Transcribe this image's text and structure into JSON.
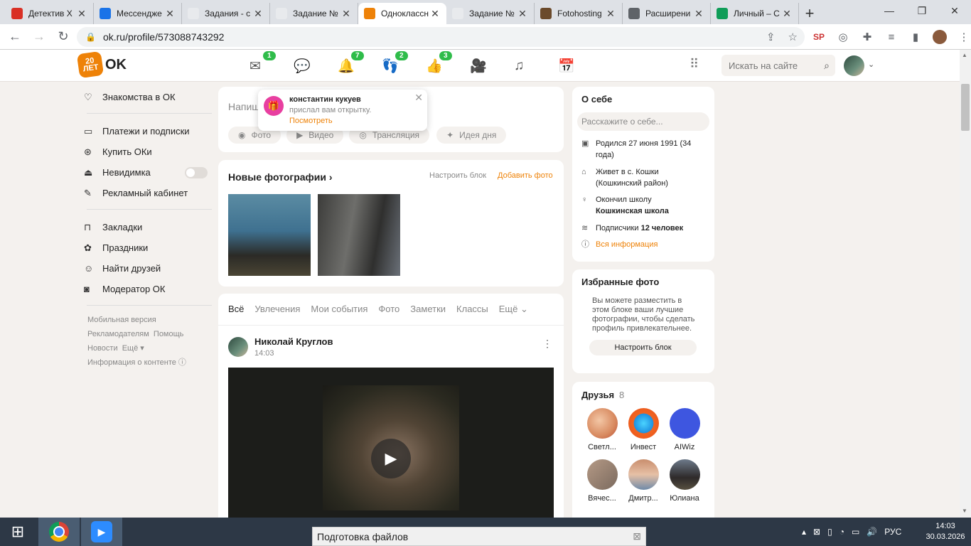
{
  "browser": {
    "tabs": [
      {
        "title": "Детектив Х",
        "icon_color": "#d93025",
        "active": false
      },
      {
        "title": "Мессендже",
        "icon_color": "#1a73e8",
        "active": false
      },
      {
        "title": "Задания - с",
        "icon_color": "#e8eaed",
        "active": false
      },
      {
        "title": "Задание №",
        "icon_color": "#e8eaed",
        "active": false
      },
      {
        "title": "Одноклассн",
        "icon_color": "#ee8208",
        "active": true
      },
      {
        "title": "Задание №",
        "icon_color": "#e8eaed",
        "active": false
      },
      {
        "title": "Fotohosting",
        "icon_color": "#6b4a2b",
        "active": false
      },
      {
        "title": "Расширени",
        "icon_color": "#5f6368",
        "active": false
      },
      {
        "title": "Личный – С",
        "icon_color": "#0f9d58",
        "active": false
      }
    ],
    "url": "ok.ru/profile/573088743292"
  },
  "site": {
    "logo_badge": "20 ЛЕТ",
    "logo_text": "OK",
    "nav": [
      {
        "icon": "mail-icon",
        "glyph": "✉",
        "count": "1"
      },
      {
        "icon": "chat-icon",
        "glyph": "💬",
        "count": ""
      },
      {
        "icon": "bell-icon",
        "glyph": "🔔",
        "count": "7"
      },
      {
        "icon": "guests-icon",
        "glyph": "👣",
        "count": "2"
      },
      {
        "icon": "like-icon",
        "glyph": "👍",
        "count": "3"
      },
      {
        "icon": "video-icon",
        "glyph": "🎥",
        "count": ""
      },
      {
        "icon": "music-icon",
        "glyph": "♫",
        "count": ""
      },
      {
        "icon": "calendar-icon",
        "glyph": "📅",
        "count": ""
      }
    ],
    "search_placeholder": "Искать на сайте"
  },
  "leftnav": {
    "top": "Знакомства в ОК",
    "group1": [
      "Платежи и подписки",
      "Купить ОКи",
      "Невидимка",
      "Рекламный кабинет"
    ],
    "group2": [
      "Закладки",
      "Праздники",
      "Найти друзей",
      "Модератор ОК"
    ],
    "footer": [
      "Мобильная версия",
      "Рекламодателям",
      "Помощь",
      "Новости",
      "Ещё ▾",
      "Информация о контенте ⓘ"
    ]
  },
  "postbox": {
    "placeholder": "Напиши",
    "buttons": [
      "Фото",
      "Видео",
      "Трансляция",
      "Идея дня"
    ]
  },
  "notification": {
    "name": "константин кукуев",
    "text": "прислал вам открытку.",
    "link": "Посмотреть"
  },
  "photos": {
    "title": "Новые фотографии ›",
    "configure": "Настроить блок",
    "add": "Добавить фото"
  },
  "feed": {
    "tabs": [
      "Всё",
      "Увлечения",
      "Мои события",
      "Фото",
      "Заметки",
      "Классы",
      "Ещё ⌄"
    ],
    "post": {
      "author": "Николай Круглов",
      "time": "14:03"
    }
  },
  "about": {
    "title": "О себе",
    "placeholder": "Расскажите о себе...",
    "born": "Родился 27 июня 1991 (34 года)",
    "lives": "Живет в с. Кошки (Кошкинский район)",
    "school_pre": "Окончил школу",
    "school": "Кошкинская школа",
    "subs_pre": "Подписчики",
    "subs": "12 человек",
    "all": "Вся информация"
  },
  "favphotos": {
    "title": "Избранные фото",
    "text": "Вы можете разместить в этом блоке ваши лучшие фотографии, чтобы сделать профиль привлекательнее.",
    "button": "Настроить блок"
  },
  "friends": {
    "title": "Друзья",
    "count": "8",
    "list": [
      "Светл...",
      "Инвест",
      "AIWiz",
      "Вячес...",
      "Дмитр...",
      "Юлиана"
    ]
  },
  "taskbar": {
    "download": "Подготовка файлов",
    "lang": "РУС",
    "time": "14:03",
    "date": "30.03.2026"
  }
}
